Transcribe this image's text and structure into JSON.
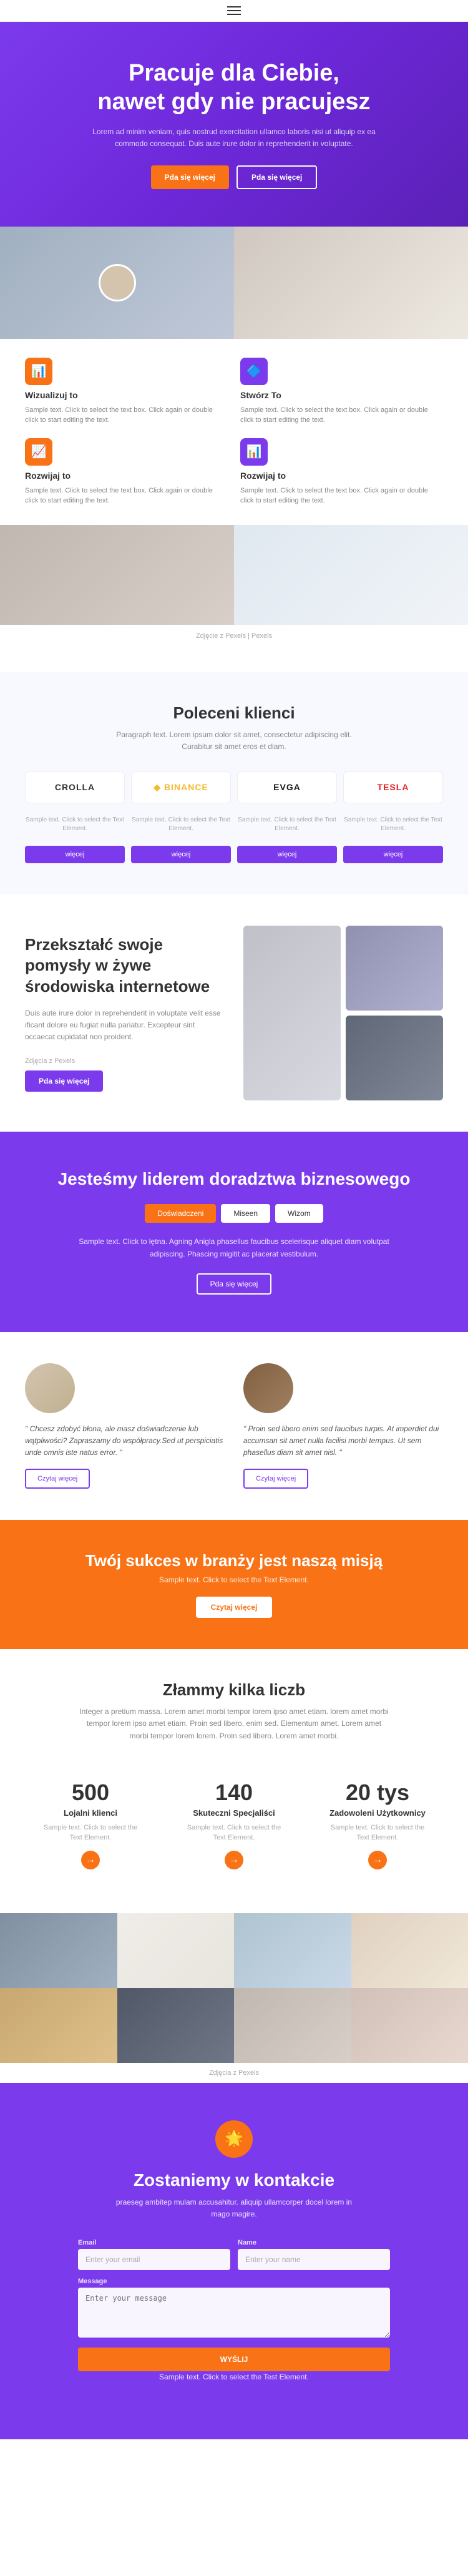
{
  "topbar": {
    "menu_icon_label": "≡"
  },
  "hero": {
    "title": "Pracuje dla Ciebie,\nnawet gdy nie pracujesz",
    "subtitle": "Lorem ad minim veniam, quis nostrud exercitation ullamco laboris nisi ut aliquip ex ea commodo consequat. Duis aute irure dolor in reprehenderit in voluptate.",
    "btn1_label": "Pda się więcej",
    "btn2_label": "Pda się więcej"
  },
  "features": {
    "items": [
      {
        "icon": "📊",
        "icon_type": "orange",
        "title": "Wizualizuj to",
        "text": "Sample text. Click to select the text box. Click again or double click to start editing the text."
      },
      {
        "icon": "🔷",
        "icon_type": "purple",
        "title": "Stwórz To",
        "text": "Sample text. Click to select the text box. Click again or double click to start editing the text."
      },
      {
        "icon": "📈",
        "icon_type": "orange",
        "title": "Rozwijaj to",
        "text": "Sample text. Click to select the text box. Click again or double click to start editing the text."
      },
      {
        "icon": "📊",
        "icon_type": "purple",
        "title": "Rozwijaj to",
        "text": "Sample text. Click to select the text box. Click again or double click to start editing the text."
      }
    ],
    "caption": "Zdjęcie z Pexels"
  },
  "clients": {
    "title": "Poleceni klienci",
    "subtitle": "Paragraph text. Lorem ipsum dolor sit amet, consectetur adipiscing elit. Curabitur sit amet eros et diam.",
    "logos": [
      {
        "name": "CROLLA",
        "class": ""
      },
      {
        "name": "◆ BINANCE",
        "class": "binance"
      },
      {
        "name": "EVGA",
        "class": "evga"
      },
      {
        "name": "TESLA",
        "class": "tesla"
      }
    ],
    "sample_texts": [
      "Sample text. Click to select the Text Element.",
      "Sample text. Click to select the Text Element.",
      "Sample text. Click to select the Text Element.",
      "Sample text. Click to select the Text Element."
    ],
    "btn_label": "więcej"
  },
  "transform": {
    "title": "Przekształć swoje pomysły w żywe środowiska internetowe",
    "text": "Duis aute irure dolor in reprehenderit in voluptate velit esse ificant dolore eu fugiat nulla pariatur. Excepteur sint occaecat cupidatat non proident.",
    "caption": "Zdjęcia z Pexels",
    "btn_label": "Pda się więcej"
  },
  "leadership": {
    "title": "Jesteśmy liderem doradztwa biznesowego",
    "tabs": [
      {
        "label": "Doświadczeni",
        "active": true
      },
      {
        "label": "Miseen",
        "active": false
      },
      {
        "label": "Wizom",
        "active": false
      }
    ],
    "text": "Sample text. Click to łętna. Agning Anigla phasellus faucibus scelerisque aliquet diam volutpat adipiscing. Phascing migitit ac placerat vestibulum.",
    "btn_label": "Pda się więcej"
  },
  "testimonials": [
    {
      "quote": "\" Chcesz zdobyć błona, ale masz doświadczenie lub wątpliwości? Zapraszamy do współpracy.Sed ut perspiciatis unde omnis iste natus error. \"",
      "btn_label": "Czytaj więcej"
    },
    {
      "quote": "\" Proin sed libero enim sed faucibus turpis. At imperdiet dui accumsan sit amet nulla facilisi morbi tempus. Ut sem phasellus diam sit amet nisl. \"",
      "btn_label": "Czytaj więcej"
    }
  ],
  "cta_banner": {
    "title": "Twój sukces w branży jest naszą misją",
    "subtitle": "Sample text. Click to select the Text Element.",
    "btn_label": "Czytaj więcej"
  },
  "numbers": {
    "title": "Złammy kilka liczb",
    "subtitle": "Integer a pretium massa. Lorem amet morbi tempor lorem ipso amet etiam. lorem amet morbi tempor lorem ipso amet etiam. Proin sed libero, enim sed. Elementum amet. Lorem amet morbi tempor lorem lorem. Proin sed libero. Lorem amet morbi.",
    "items": [
      {
        "value": "500",
        "label": "Lojalni klienci",
        "text": "Sample text. Click to select the Text Element."
      },
      {
        "value": "140",
        "label": "Skuteczni Specjaliści",
        "text": "Sample text. Click to select the Text Element."
      },
      {
        "value": "20 tys",
        "label": "Zadowoleni Użytkownicy",
        "text": "Sample text. Click to select the Text Element."
      }
    ]
  },
  "gallery": {
    "caption": "Zdjęcia z Pexels"
  },
  "contact": {
    "icon": "🌟",
    "title": "Zostaniemy w kontakcie",
    "subtitle": "praeseg ambitep mulam accusahitur. aliquip ullamcorper docel lorem in mago magire.",
    "form": {
      "email_label": "Email",
      "email_placeholder": "Enter your email",
      "name_label": "Name",
      "name_placeholder": "Enter your name",
      "message_label": "Message",
      "message_placeholder": "Enter your message",
      "submit_label": "WYŚLIJ"
    },
    "footer_text": "Sample text. Click to select the Test Element."
  }
}
